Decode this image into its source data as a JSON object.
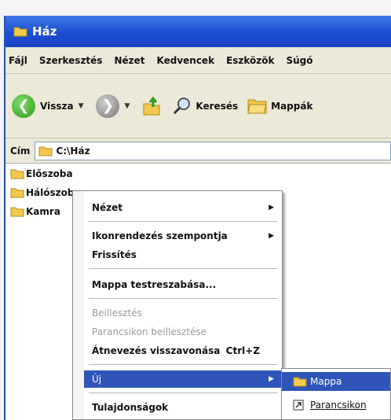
{
  "window": {
    "title": "Ház"
  },
  "menubar": {
    "items": [
      "Fájl",
      "Szerkesztés",
      "Nézet",
      "Kedvencek",
      "Eszközök",
      "Súgó"
    ]
  },
  "toolbar": {
    "back_label": "Vissza",
    "search_label": "Keresés",
    "folders_label": "Mappák"
  },
  "address": {
    "label": "Cím",
    "value": "C:\\Ház"
  },
  "folders": [
    "Előszoba",
    "Hálószoba",
    "Kamra"
  ],
  "context_menu": {
    "view": "Nézet",
    "arrange": "Ikonrendezés szempontja",
    "refresh": "Frissítés",
    "customize": "Mappa testreszabása...",
    "paste": "Beillesztés",
    "paste_shortcut": "Parancsikon beillesztése",
    "undo_rename": "Átnevezés visszavonása",
    "undo_shortcut": "Ctrl+Z",
    "new": "Új",
    "properties": "Tulajdonságok"
  },
  "submenu": {
    "folder": "Mappa",
    "shortcut": "Parancsikon"
  },
  "colors": {
    "title_bar": "#1c4ecf",
    "highlight": "#2f55b8",
    "folder": "#f2c94c"
  }
}
